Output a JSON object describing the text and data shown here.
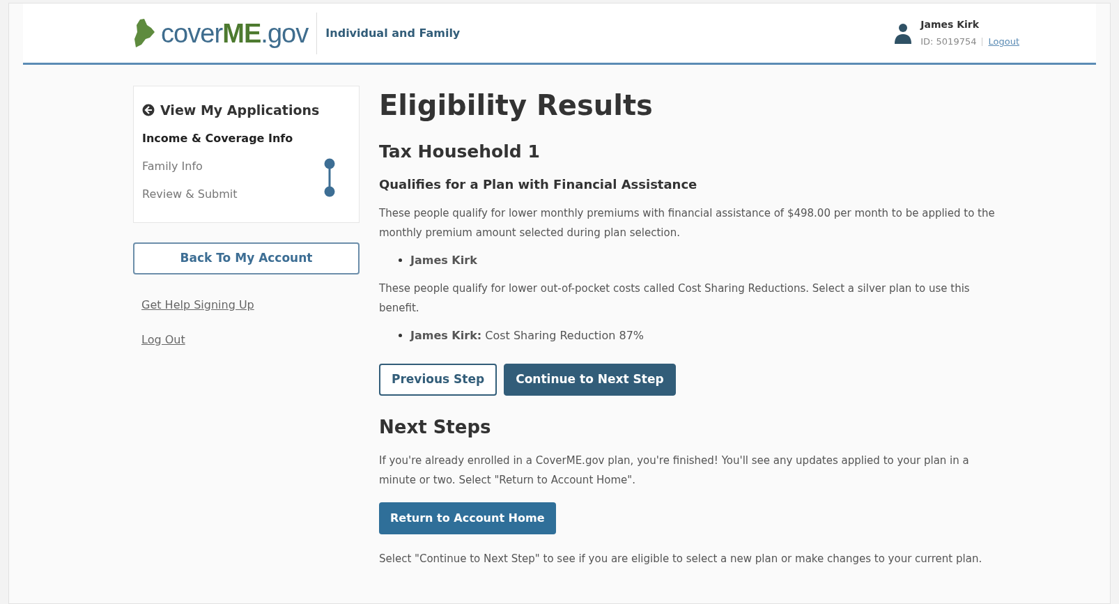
{
  "header": {
    "logo": {
      "prefix": "cover",
      "highlight": "ME",
      "suffix": ".gov"
    },
    "tagline": "Individual and Family",
    "user": {
      "name": "James Kirk",
      "id": "ID: 5019754",
      "logout": "Logout"
    }
  },
  "sidebar": {
    "back_link": "View My Applications",
    "steps": [
      {
        "label": "Income & Coverage Info",
        "kind": "section",
        "selected": true
      },
      {
        "label": "Family Info",
        "kind": "step",
        "selected": false
      },
      {
        "label": "Review & Submit",
        "kind": "step",
        "selected": false
      }
    ],
    "account_button": "Back To My Account",
    "links": [
      "Get Help Signing Up",
      "Log Out"
    ]
  },
  "main": {
    "title": "Eligibility Results",
    "household": "Tax Household 1",
    "qualification": "Qualifies for a Plan with Financial Assistance",
    "sections": [
      {
        "text": "These people qualify for lower monthly premiums with financial assistance of $498.00 per month to be applied to the monthly premium amount selected during plan selection.",
        "people": [
          "**James Kirk**"
        ]
      },
      {
        "text": "These people qualify for lower out-of-pocket costs called Cost Sharing Reductions. Select a silver plan to use this benefit.",
        "people": [
          "**James Kirk:** Cost Sharing Reduction 87%"
        ]
      }
    ],
    "buttons": [
      {
        "label": "Previous Step",
        "kind": "secondary"
      },
      {
        "label": "Continue to Next Step",
        "kind": "primary"
      }
    ],
    "next_steps": {
      "title": "Next Steps",
      "text": "If you're already enrolled in a CoverME.gov plan, you're finished! You'll see any updates applied to your plan in a minute or two. Select \"Return to Account Home\".",
      "button": "Return to Account Home",
      "footer": "Select \"Continue to Next Step\" to see if you are eligible to select a new plan or make changes to your current plan."
    }
  }
}
